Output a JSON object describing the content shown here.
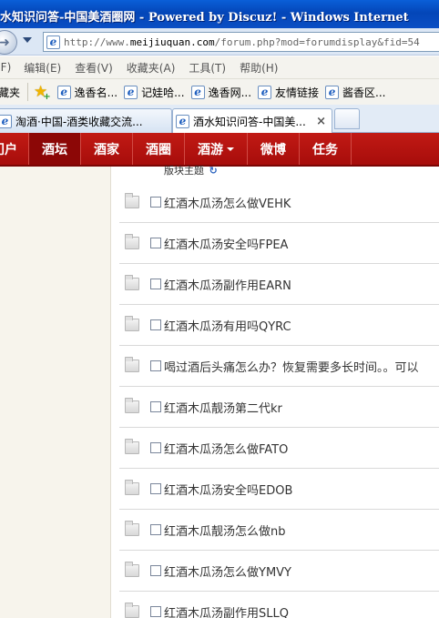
{
  "window": {
    "title": "水知识问答-中国美酒圈网 - Powered by Discuz! - Windows Internet"
  },
  "address_bar": {
    "url_prefix": "http://www.",
    "url_host": "meijiuquan.com",
    "url_path": "/forum.php?mod=forumdisplay&fid=54"
  },
  "menu": {
    "items": [
      "(F)",
      "编辑(E)",
      "查看(V)",
      "收藏夹(A)",
      "工具(T)",
      "帮助(H)"
    ]
  },
  "favorites": {
    "label": "藏夹",
    "items": [
      "逸香名...",
      "记娃哈...",
      "逸香网...",
      "友情链接",
      "酱香区..."
    ]
  },
  "tabs": [
    {
      "label": "淘酒·中国-酒类收藏交流..."
    },
    {
      "label": "酒水知识问答-中国美...",
      "close": "×"
    }
  ],
  "site_nav": {
    "items": [
      {
        "label": "门户"
      },
      {
        "label": "酒坛"
      },
      {
        "label": "酒家"
      },
      {
        "label": "酒圈"
      },
      {
        "label": "酒游"
      },
      {
        "label": "微博"
      },
      {
        "label": "任务"
      }
    ]
  },
  "thread_list": {
    "header": "版块主题",
    "refresh_glyph": "↻",
    "threads": [
      "红酒木瓜汤怎么做VEHK",
      "红酒木瓜汤安全吗FPEA",
      "红酒木瓜汤副作用EARN",
      "红酒木瓜汤有用吗QYRC",
      "喝过酒后头痛怎么办？恢复需要多长时间。。可以",
      "红酒木瓜靓汤第二代kr",
      "红酒木瓜汤怎么做FATO",
      "红酒木瓜汤安全吗EDOB",
      "红酒木瓜靓汤怎么做nb",
      "红酒木瓜汤怎么做YMVY",
      "红酒木瓜汤副作用SLLQ"
    ]
  },
  "colors": {
    "nav_red": "#b51410",
    "nav_active": "#8c0706",
    "titlebar_blue": "#0a4ec4"
  }
}
